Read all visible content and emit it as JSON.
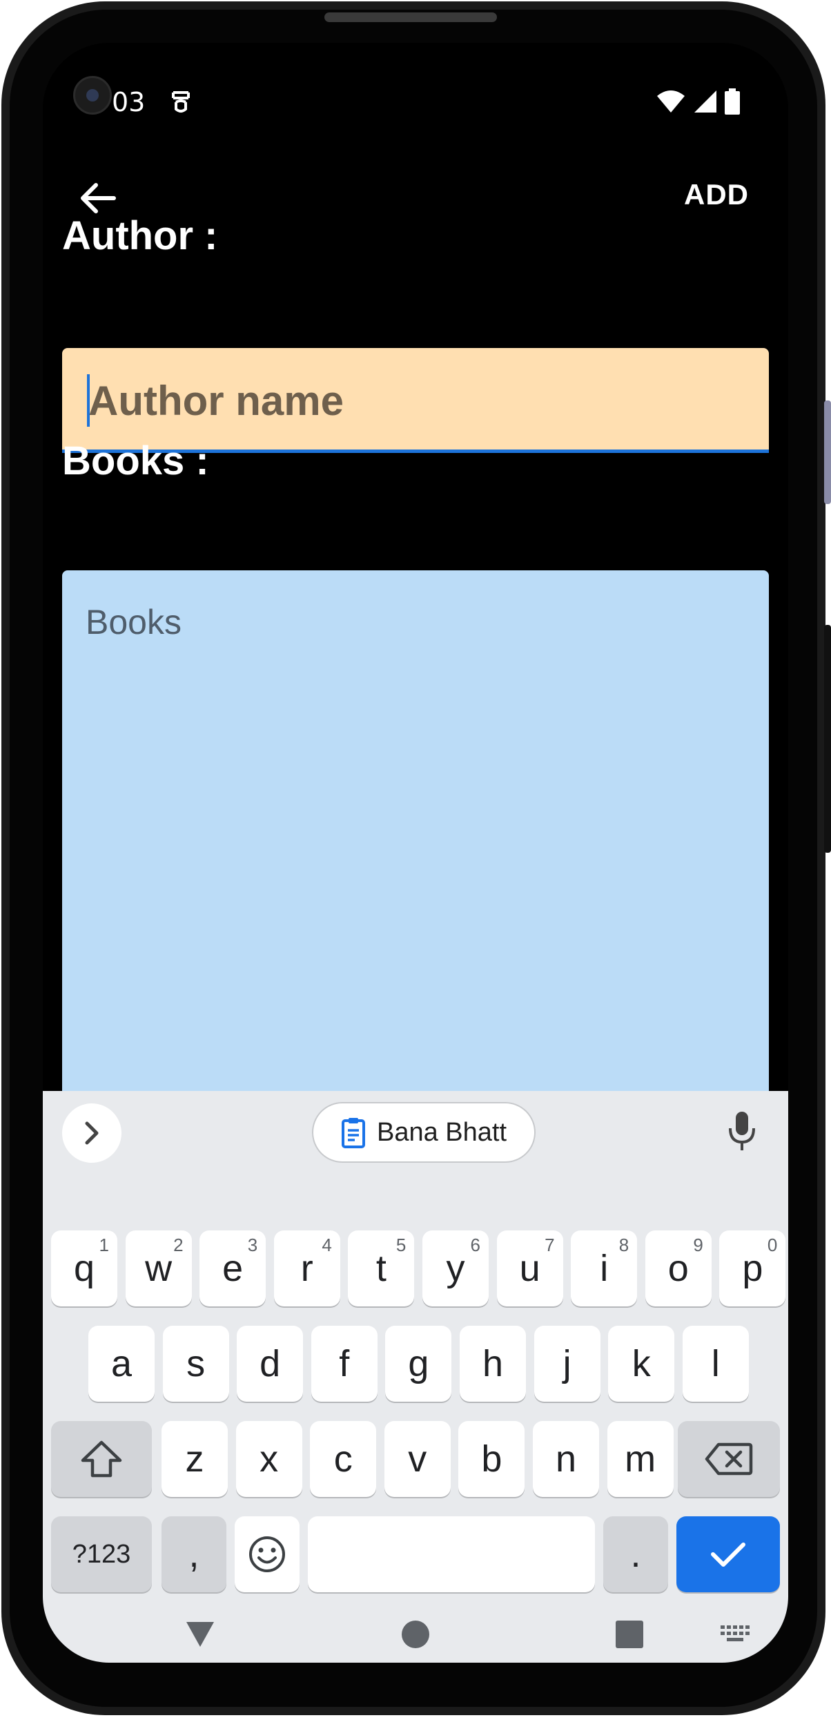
{
  "status_bar": {
    "time": "03"
  },
  "app_bar": {
    "action_label": "ADD"
  },
  "author": {
    "label": "Author :",
    "placeholder": "Author name"
  },
  "books": {
    "label": "Books :",
    "placeholder": "Books"
  },
  "keyboard": {
    "suggestion": "Bana Bhatt",
    "row1": [
      {
        "k": "q",
        "n": "1"
      },
      {
        "k": "w",
        "n": "2"
      },
      {
        "k": "e",
        "n": "3"
      },
      {
        "k": "r",
        "n": "4"
      },
      {
        "k": "t",
        "n": "5"
      },
      {
        "k": "y",
        "n": "6"
      },
      {
        "k": "u",
        "n": "7"
      },
      {
        "k": "i",
        "n": "8"
      },
      {
        "k": "o",
        "n": "9"
      },
      {
        "k": "p",
        "n": "0"
      }
    ],
    "row2": [
      "a",
      "s",
      "d",
      "f",
      "g",
      "h",
      "j",
      "k",
      "l"
    ],
    "row3": [
      "z",
      "x",
      "c",
      "v",
      "b",
      "n",
      "m"
    ],
    "symbols_label": "?123",
    "comma": ",",
    "period": "."
  },
  "colors": {
    "author_field_bg": "#ffdfb1",
    "books_field_bg": "#bbdcf7",
    "accent": "#1a73e8"
  },
  "icons": {
    "back": "arrow-left-icon",
    "status": [
      "alarm-icon",
      "wifi-icon",
      "signal-icon",
      "battery-icon"
    ],
    "keyboard": [
      "chevron-right-icon",
      "clipboard-icon",
      "mic-icon",
      "shift-icon",
      "backspace-icon",
      "emoji-icon",
      "check-icon"
    ],
    "nav": [
      "back-triangle-icon",
      "home-circle-icon",
      "recents-square-icon",
      "keyboard-switch-icon"
    ]
  }
}
